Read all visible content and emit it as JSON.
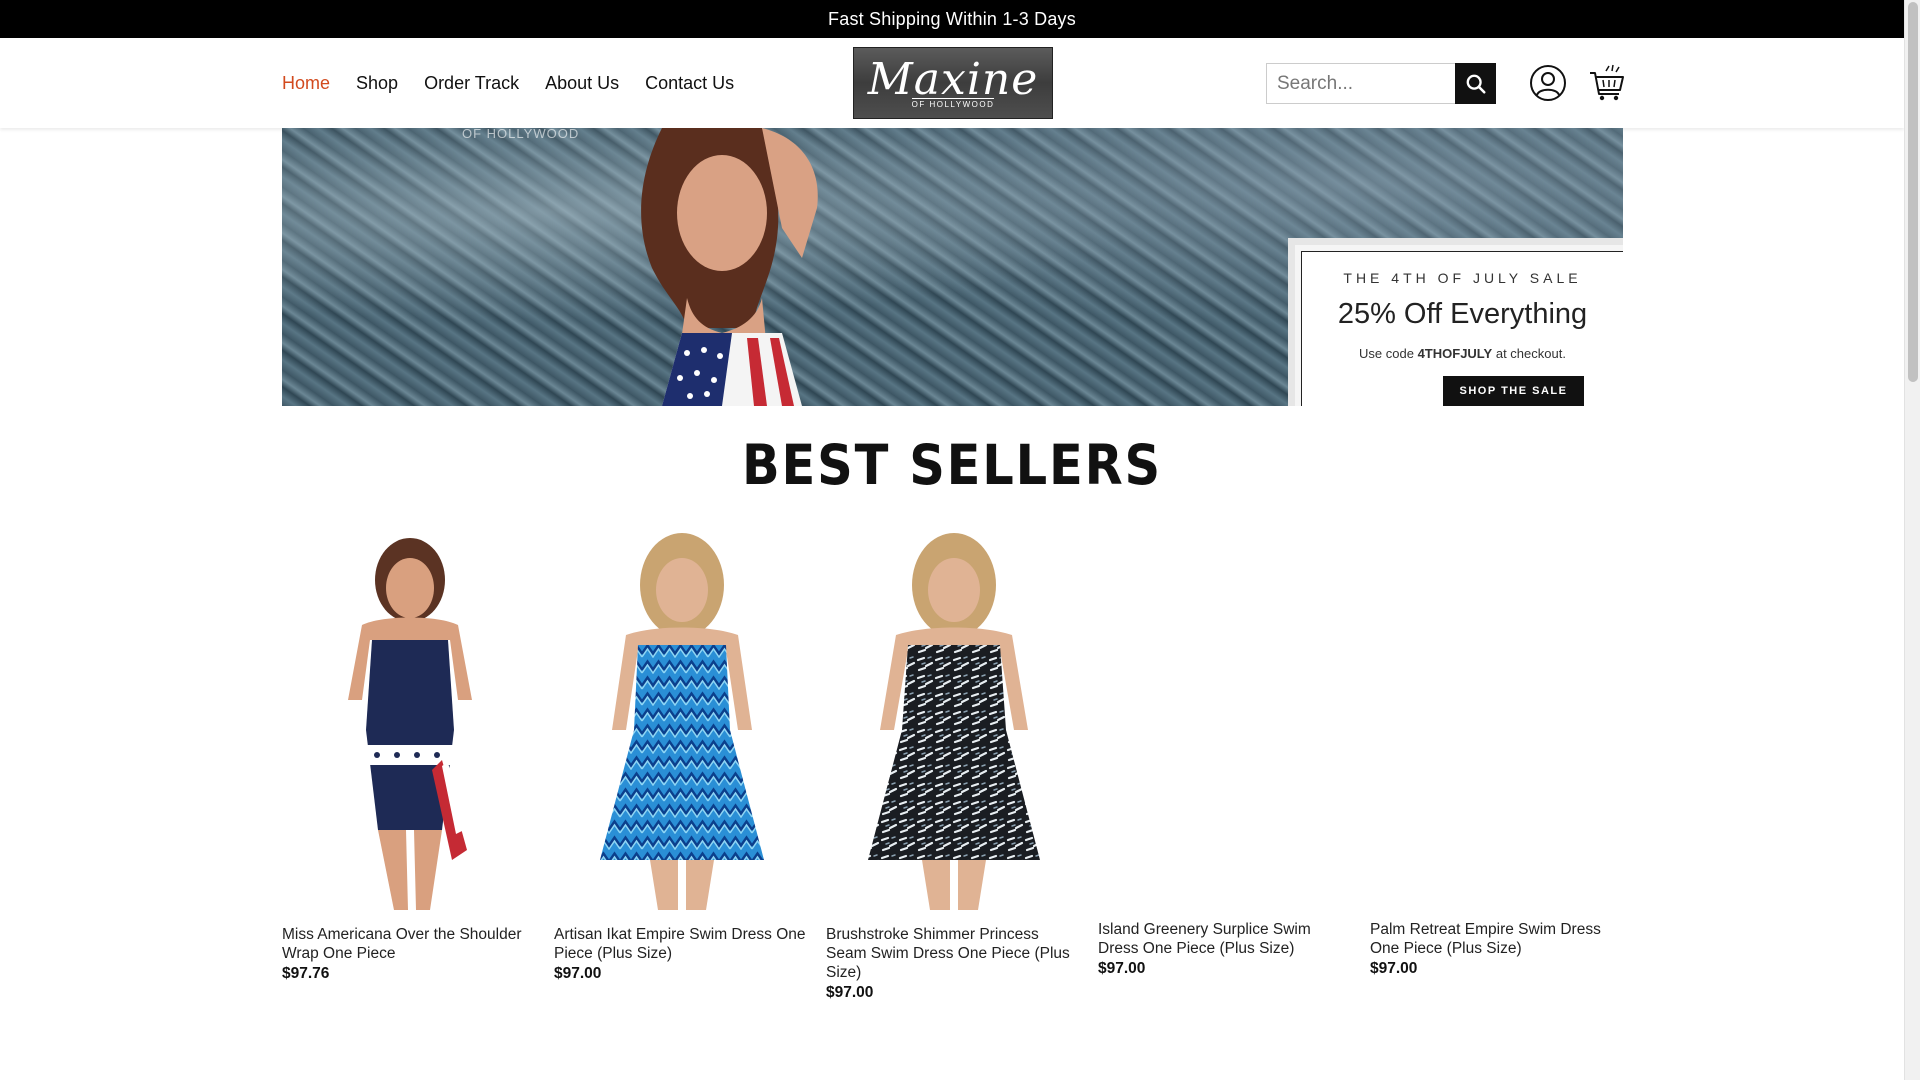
{
  "announcement": "Fast Shipping Within 1-3 Days",
  "nav": {
    "items": [
      {
        "label": "Home",
        "active": true
      },
      {
        "label": "Shop",
        "active": false
      },
      {
        "label": "Order Track",
        "active": false
      },
      {
        "label": "About Us",
        "active": false
      },
      {
        "label": "Contact Us",
        "active": false
      }
    ]
  },
  "logo": {
    "script": "Maxine",
    "sub": "OF HOLLYWOOD"
  },
  "search": {
    "placeholder": "Search..."
  },
  "icons": {
    "search": "search-icon",
    "account": "user-icon",
    "cart": "cart-icon"
  },
  "hero": {
    "watermark": "OF HOLLYWOOD",
    "eyebrow": "THE 4TH OF JULY SALE",
    "headline": "25% Off Everything",
    "code_prefix": "Use code ",
    "code": "4THOFJULY",
    "code_suffix": " at checkout.",
    "cta": "SHOP THE SALE"
  },
  "best_sellers": {
    "title": "BEST SELLERS",
    "products": [
      {
        "name": "Miss Americana Over the Shoulder Wrap One Piece",
        "price": "$97.76",
        "image": "navy-swimsuit-flag-wrap"
      },
      {
        "name": "Artisan Ikat Empire Swim Dress One Piece (Plus Size)",
        "price": "$97.00",
        "image": "blue-ikat-swim-dress"
      },
      {
        "name": "Brushstroke Shimmer Princess Seam Swim Dress One Piece (Plus Size)",
        "price": "$97.00",
        "image": "black-white-print-swim-dress"
      },
      {
        "name": "Island Greenery Surplice Swim Dress One Piece (Plus Size)",
        "price": "$97.00",
        "image": ""
      },
      {
        "name": "Palm Retreat Empire Swim Dress One Piece (Plus Size)",
        "price": "$97.00",
        "image": ""
      }
    ]
  },
  "colors": {
    "accent": "#d24a1e",
    "topbar": "#000000",
    "text": "#111111"
  }
}
